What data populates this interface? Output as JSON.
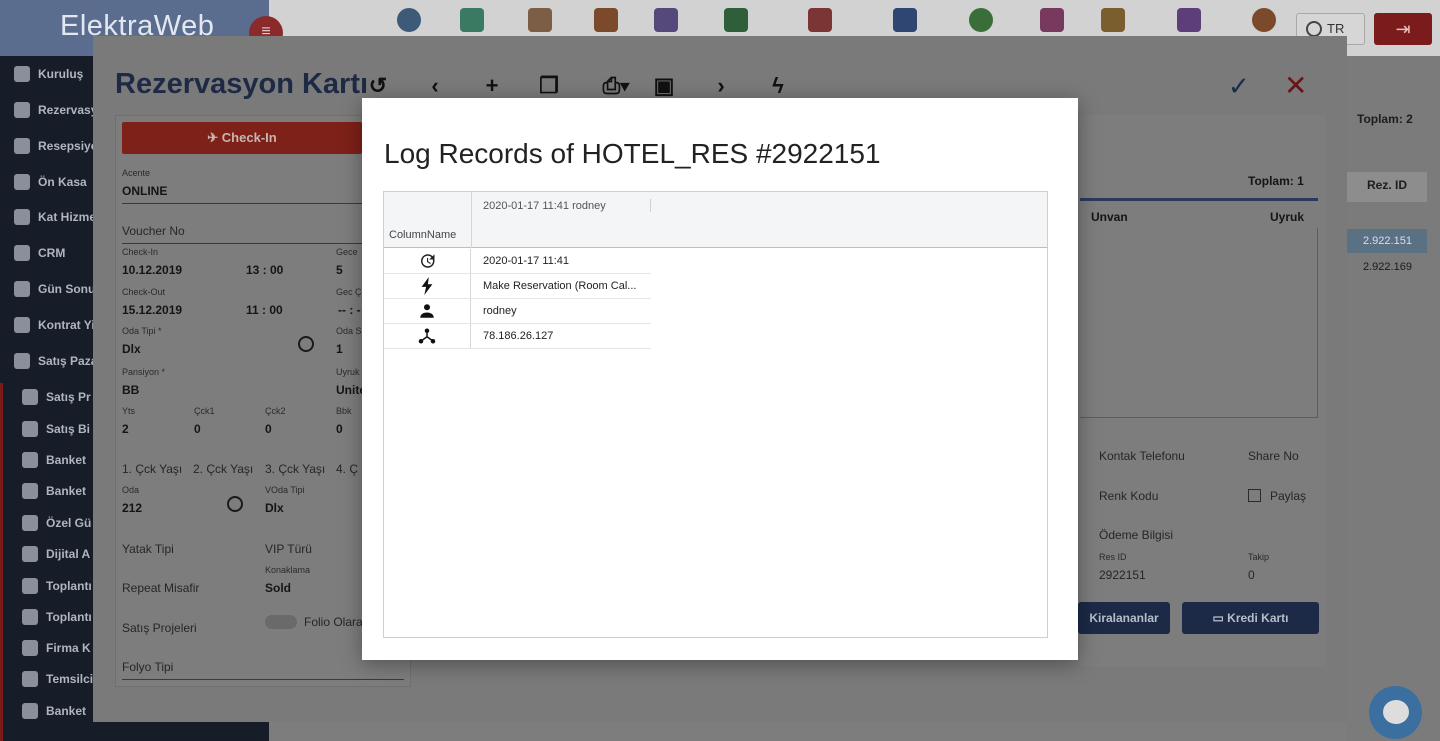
{
  "app": {
    "logo": "ElektraWeb",
    "language": "TR"
  },
  "toolbar_icons": [
    "pie-chart-icon",
    "grid-icon",
    "bar-chart-icon",
    "table-icon",
    "calendar-icon",
    "laptop-icon",
    "plane-landing-icon",
    "bed-icon",
    "dollar-icon",
    "hand-icon",
    "cart-plus-icon",
    "cart-icon",
    "alarm-icon"
  ],
  "sidebar": {
    "items": [
      {
        "label": "Kuruluş",
        "icon": "gavel-icon"
      },
      {
        "label": "Rezervasy",
        "icon": "plane-icon"
      },
      {
        "label": "Resepsiyo",
        "icon": "home-icon"
      },
      {
        "label": "Ön Kasa",
        "icon": "dollar-icon"
      },
      {
        "label": "Kat Hizme",
        "icon": "person-icon"
      },
      {
        "label": "CRM",
        "icon": "globe-icon"
      },
      {
        "label": "Gün Sonu",
        "icon": "calendar-icon"
      },
      {
        "label": "Kontrat Yi",
        "icon": "tag-icon"
      },
      {
        "label": "Satış Paza",
        "icon": "people-icon"
      },
      {
        "label": "Satış Pr",
        "icon": "pie-icon"
      },
      {
        "label": "Satış Bi",
        "icon": "pie-icon"
      },
      {
        "label": "Banket",
        "icon": "calendar-icon"
      },
      {
        "label": "Banket",
        "icon": "grid-icon"
      },
      {
        "label": "Özel Gü",
        "icon": "pie-icon"
      },
      {
        "label": "Dijital A",
        "icon": "clip-icon"
      },
      {
        "label": "Toplantı",
        "icon": "calendar-icon"
      },
      {
        "label": "Toplantı",
        "icon": "close-circle-icon"
      },
      {
        "label": "Firma K",
        "icon": "plane-icon"
      },
      {
        "label": "Temsilci",
        "icon": "people-icon"
      },
      {
        "label": "Banket",
        "icon": "doc-icon"
      }
    ]
  },
  "background": {
    "toplam": "Toplam: 2",
    "rez_id_header": "Rez. ID",
    "rows": [
      "2.922.151",
      "2.922.169"
    ]
  },
  "reservation_card": {
    "title": "Rezervasyon Kartı",
    "checkin_button": "Check-In",
    "fields": {
      "acente_label": "Acente",
      "acente_value": "ONLINE",
      "voucher_placeholder": "Voucher No",
      "checkin_label": "Check-In",
      "checkin_date": "10.12.2019",
      "checkin_time": "13 : 00",
      "gece_label": "Gece",
      "gece_value": "5",
      "checkout_label": "Check-Out",
      "checkout_date": "15.12.2019",
      "checkout_time": "11 : 00",
      "gec_label": "Gec Ç",
      "gec_value": "-- : -",
      "oda_tipi_label": "Oda Tipi *",
      "oda_tipi_value": "Dlx",
      "oda_s_label": "Oda S",
      "oda_s_value": "1",
      "pansiyon_label": "Pansiyon *",
      "pansiyon_value": "BB",
      "uyruk_label": "Uyruk",
      "uyruk_value": "Unite",
      "yts_label": "Yts",
      "yts_value": "2",
      "cck1_label": "Çck1",
      "cck1_value": "0",
      "cck2_label": "Çck2",
      "cck2_value": "0",
      "bbk_label": "Bbk",
      "bbk_value": "0",
      "cck_yas1": "1. Çck Yaşı",
      "cck_yas2": "2. Çck Yaşı",
      "cck_yas3": "3. Çck Yaşı",
      "cck_yas4": "4. Ç",
      "oda_label": "Oda",
      "oda_value": "212",
      "voda_label": "VOda Tipi",
      "voda_value": "Dlx",
      "yatak_tipi": "Yatak Tipi",
      "vip_turu": "VIP Türü",
      "repeat_misafir": "Repeat Misafir",
      "konaklama_label": "Konaklama",
      "konaklama_value": "Sold",
      "satis_projeleri": "Satış Projeleri",
      "folio_olara": "Folio Olara",
      "folyo_tipi": "Folyo Tipi"
    },
    "right_panel": {
      "toplam": "Toplam: 1",
      "unvan": "Unvan",
      "uyruk": "Uyruk",
      "kontak_telefonu": "Kontak Telefonu",
      "share_no": "Share No",
      "renk_kodu": "Renk Kodu",
      "paylas": "Paylaş",
      "odeme_bilgisi": "Ödeme Bilgisi",
      "res_id_label": "Res ID",
      "res_id_value": "2922151",
      "takip_label": "Takip",
      "takip_value": "0",
      "kiralananlar": "Kiralananlar",
      "kredi_karti": "Kredi Kartı"
    }
  },
  "log_dialog": {
    "title": "Log Records of HOTEL_RES #2922151",
    "column_header": "ColumnName",
    "record_header": "2020-01-17 11:41 rodney",
    "rows": [
      {
        "icon": "history-icon",
        "value": "2020-01-17 11:41"
      },
      {
        "icon": "lightning-icon",
        "value": "Make Reservation (Room Cal..."
      },
      {
        "icon": "user-icon",
        "value": "rodney"
      },
      {
        "icon": "network-icon",
        "value": "78.186.26.127"
      }
    ]
  },
  "colors": {
    "sidebar": "#161c28",
    "accent_navy": "#1c2a48",
    "checkin_red": "#7e2118"
  }
}
